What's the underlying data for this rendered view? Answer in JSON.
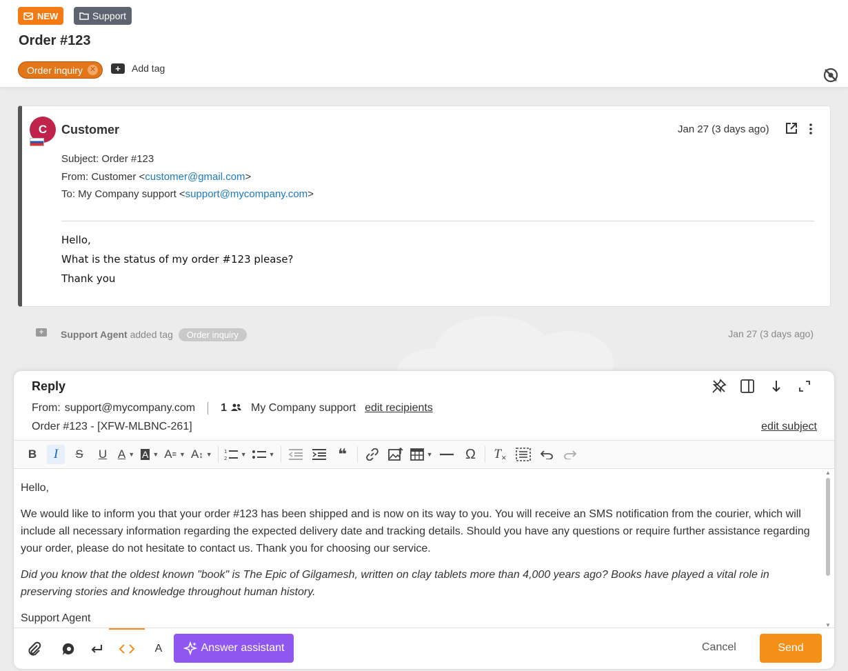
{
  "header": {
    "badge_new": "NEW",
    "badge_folder": "Support",
    "title": "Order #123",
    "tag": "Order inquiry",
    "add_tag": "Add tag"
  },
  "message": {
    "avatar_letter": "C",
    "sender": "Customer",
    "date": "Jan 27 (3 days ago)",
    "subject_line": "Subject: Order #123",
    "from_prefix": "From: Customer <",
    "from_email": "customer@gmail.com",
    "from_suffix": ">",
    "to_prefix": "To: My Company support <",
    "to_email": "support@mycompany.com",
    "to_suffix": ">",
    "body": [
      "Hello,",
      "What is the status of my order #123 please?",
      "Thank you"
    ]
  },
  "activity": {
    "actor": "Support Agent",
    "action": "added tag",
    "tag": "Order inquiry",
    "date": "Jan 27 (3 days ago)"
  },
  "reply": {
    "title": "Reply",
    "from_label": "From:",
    "from_email": "support@mycompany.com",
    "recipient_count": "1",
    "recipient_name": "My Company support",
    "edit_recipients": "edit recipients",
    "subject": "Order #123 - [XFW-MLBNC-261]",
    "edit_subject": "edit subject",
    "editor": {
      "greeting": "Hello,",
      "paragraph": "We would like to inform you that your order #123 has been shipped and is now on its way to you. You will receive an SMS notification from the courier, which will include all necessary information regarding the expected delivery date and tracking details. Should you have any questions or require further assistance regarding your order, please do not hesitate to contact us. Thank you for choosing our service.",
      "fact": "Did you know that the oldest known \"book\" is The Epic of Gilgamesh, written on clay tablets more than 4,000 years ago? Books have played a vital role in preserving stories and knowledge throughout human history.",
      "signature": "Support Agent"
    },
    "toolbar": {
      "bold": "B",
      "italic": "I",
      "strike": "S",
      "underline": "U",
      "font_color": "A",
      "bg_color": "A",
      "font_family": "A",
      "font_size": "A",
      "blockquote": "❝",
      "special_char": "Ω",
      "clear_format": "T"
    },
    "bottom": {
      "source_label": "A",
      "assistant": "Answer assistant",
      "cancel": "Cancel",
      "send": "Send"
    }
  },
  "colors": {
    "accent_orange": "#f47b14",
    "send_orange": "#f49018",
    "assistant_purple": "#8f56f0",
    "link_blue": "#1a79c4",
    "avatar_red": "#c0234a"
  }
}
